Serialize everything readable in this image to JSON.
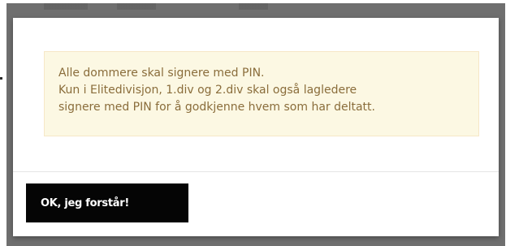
{
  "alert": {
    "lines": [
      "Alle dommere skal signere med PIN.",
      "Kun i Elitedivisjon, 1.div og 2.div skal også lagledere",
      "signere med PIN for å godkjenne hvem som har deltatt."
    ]
  },
  "footer": {
    "confirm_label": "OK, jeg forstår!"
  },
  "colors": {
    "alert_background": "#fcf8e3",
    "alert_text": "#8a6d3b",
    "button_background": "#050505",
    "backdrop": "#6f6f6f"
  }
}
